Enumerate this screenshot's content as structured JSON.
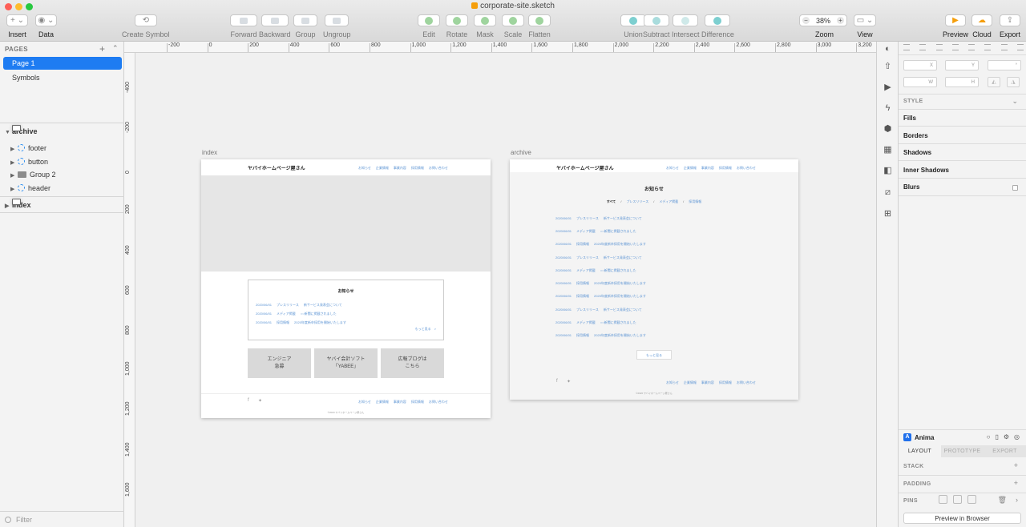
{
  "window": {
    "title": "corporate-site.sketch"
  },
  "toolbar": {
    "insert": "Insert",
    "data": "Data",
    "create_symbol": "Create Symbol",
    "forward": "Forward",
    "backward": "Backward",
    "group": "Group",
    "ungroup": "Ungroup",
    "edit": "Edit",
    "rotate": "Rotate",
    "mask": "Mask",
    "scale": "Scale",
    "flatten": "Flatten",
    "union": "Union",
    "subtract": "Subtract",
    "intersect": "Intersect",
    "difference": "Difference",
    "zoom_value": "38%",
    "zoom": "Zoom",
    "view": "View",
    "preview": "Preview",
    "cloud": "Cloud",
    "export": "Export"
  },
  "left_panel": {
    "pages_header": "PAGES",
    "pages": [
      "Page 1",
      "Symbols"
    ],
    "layers": {
      "archive": "archive",
      "children": [
        "footer",
        "button",
        "Group 2",
        "header"
      ],
      "index": "index"
    },
    "filter_placeholder": "Filter"
  },
  "rulers": {
    "horizontal": [
      "-200",
      "0",
      "200",
      "400",
      "600",
      "800",
      "1,000",
      "1,200",
      "1,400",
      "1,600",
      "1,800",
      "2,000",
      "2,200",
      "2,400",
      "2,600",
      "2,800",
      "3,000",
      "3,200"
    ],
    "vertical": [
      "-400",
      "-200",
      "0",
      "200",
      "400",
      "600",
      "800",
      "1,000",
      "1,200",
      "1,400",
      "1,600"
    ]
  },
  "artboards": {
    "index": {
      "label": "index",
      "logo": "ヤバイホームページ屋さん",
      "nav": [
        "お知らせ",
        "企業情報",
        "事業内容",
        "採用情報",
        "お問い合わせ"
      ],
      "news_title": "お知らせ",
      "news": [
        {
          "date": "2020/06/01",
          "cat": "プレスリリース",
          "text": "新サービス発表会について"
        },
        {
          "date": "2020/06/01",
          "cat": "メディア掲載",
          "text": "○○新聞に掲載されました"
        },
        {
          "date": "2020/06/01",
          "cat": "採用情報",
          "text": "2020年度新卒採用を開始いたします"
        }
      ],
      "more": "もっと見る　>",
      "buttons": [
        "エンジニア\n急募",
        "ヤバイ会計ソフト\n「YABEE」",
        "広報ブログは\nこちら"
      ],
      "footer_nav": [
        "お知らせ",
        "企業情報",
        "事業内容",
        "採用情報",
        "お問い合わせ"
      ],
      "copyright": "©2020 ヤバイホームページ屋さん"
    },
    "archive": {
      "label": "archive",
      "logo": "ヤバイホームページ屋さん",
      "nav": [
        "お知らせ",
        "企業情報",
        "事業内容",
        "採用情報",
        "お問い合わせ"
      ],
      "title": "お知らせ",
      "filters": [
        "すべて",
        "/",
        "プレスリリース",
        "/",
        "メディア掲載",
        "/",
        "採用情報"
      ],
      "rows": [
        {
          "date": "2020/06/01",
          "cat": "プレスリリース",
          "text": "新サービス発表会について"
        },
        {
          "date": "2020/06/01",
          "cat": "メディア掲載",
          "text": "○○新聞に掲載されました"
        },
        {
          "date": "2020/06/01",
          "cat": "採用情報",
          "text": "2020年度新卒採用を開始いたします"
        },
        {
          "date": "2020/06/01",
          "cat": "プレスリリース",
          "text": "新サービス発表会について"
        },
        {
          "date": "2020/06/01",
          "cat": "メディア掲載",
          "text": "○○新聞に掲載されました"
        },
        {
          "date": "2020/06/01",
          "cat": "採用情報",
          "text": "2020年度新卒採用を開始いたします"
        },
        {
          "date": "2020/06/01",
          "cat": "採用情報",
          "text": "2020年度新卒採用を開始いたします"
        },
        {
          "date": "2020/06/01",
          "cat": "プレスリリース",
          "text": "新サービス発表会について"
        },
        {
          "date": "2020/06/01",
          "cat": "メディア掲載",
          "text": "○○新聞に掲載されました"
        },
        {
          "date": "2020/06/01",
          "cat": "採用情報",
          "text": "2020年度新卒採用を開始いたします"
        }
      ],
      "more_button": "もっと見る",
      "footer_nav": [
        "お知らせ",
        "企業情報",
        "事業内容",
        "採用情報",
        "お問い合わせ"
      ],
      "copyright": "©2020 ヤバイホームページ屋さん"
    }
  },
  "inspector": {
    "x_label": "X",
    "y_label": "Y",
    "deg_label": "°",
    "w_label": "W",
    "h_label": "H",
    "style": "STYLE",
    "fills": "Fills",
    "borders": "Borders",
    "shadows": "Shadows",
    "inner_shadows": "Inner Shadows",
    "blurs": "Blurs"
  },
  "anima": {
    "title": "Anima",
    "tabs": [
      "LAYOUT",
      "PROTOTYPE",
      "EXPORT"
    ],
    "stack": "STACK",
    "padding": "PADDING",
    "pins": "PINS",
    "preview_button": "Preview in Browser"
  },
  "colors": {
    "selection": "#1e7cf2",
    "link": "#5b93d3",
    "accent": "#f59e0b"
  }
}
